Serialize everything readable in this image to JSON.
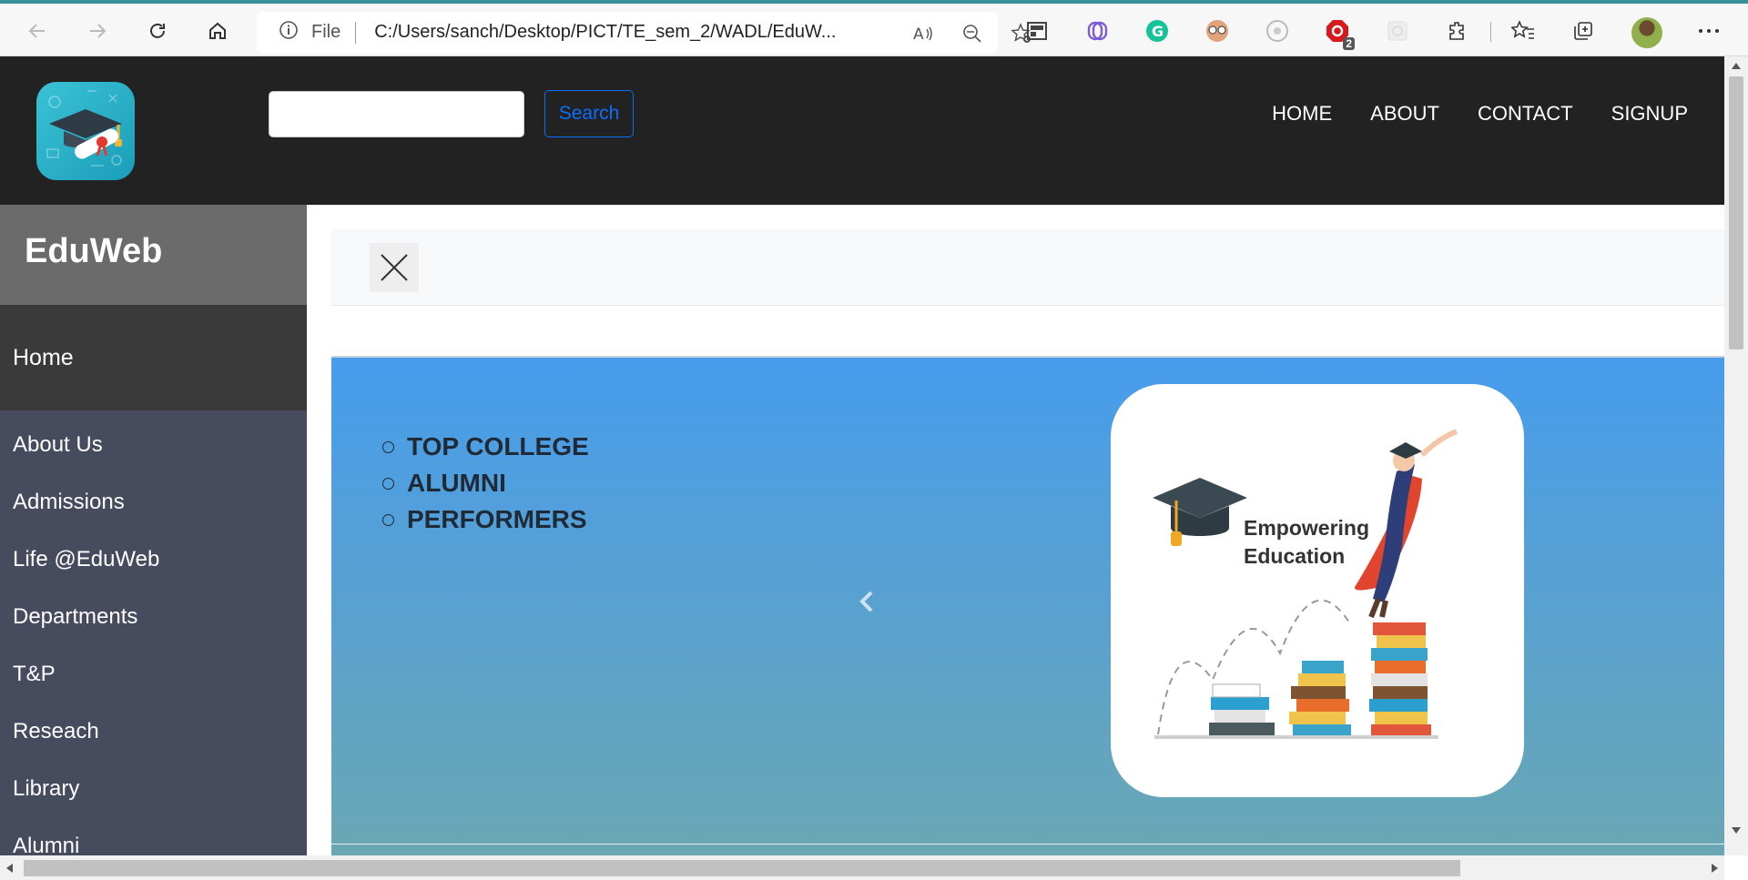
{
  "browser": {
    "address_label": "File",
    "url": "C:/Users/sanch/Desktop/PICT/TE_sem_2/WADL/EduW...",
    "extension_badge": "2"
  },
  "header": {
    "search_placeholder": "",
    "search_button": "Search",
    "menu": [
      "HOME",
      "ABOUT",
      "CONTACT",
      "SIGNUP"
    ]
  },
  "sidebar": {
    "brand": "EduWeb",
    "active": "Home",
    "items": [
      "About Us",
      "Admissions",
      "Life @EduWeb",
      "Departments",
      "T&P",
      "Reseach",
      "Library",
      "Alumni"
    ]
  },
  "carousel": {
    "list": [
      "TOP COLLEGE",
      "ALUMNI",
      "PERFORMERS"
    ],
    "promo_line1": "Empowering",
    "promo_line2": "Education"
  },
  "colors": {
    "nav_bg": "#222222",
    "sidebar_bg": "#474b5e",
    "brand_bg": "#6b6b6b",
    "accent": "#0d6efd"
  }
}
